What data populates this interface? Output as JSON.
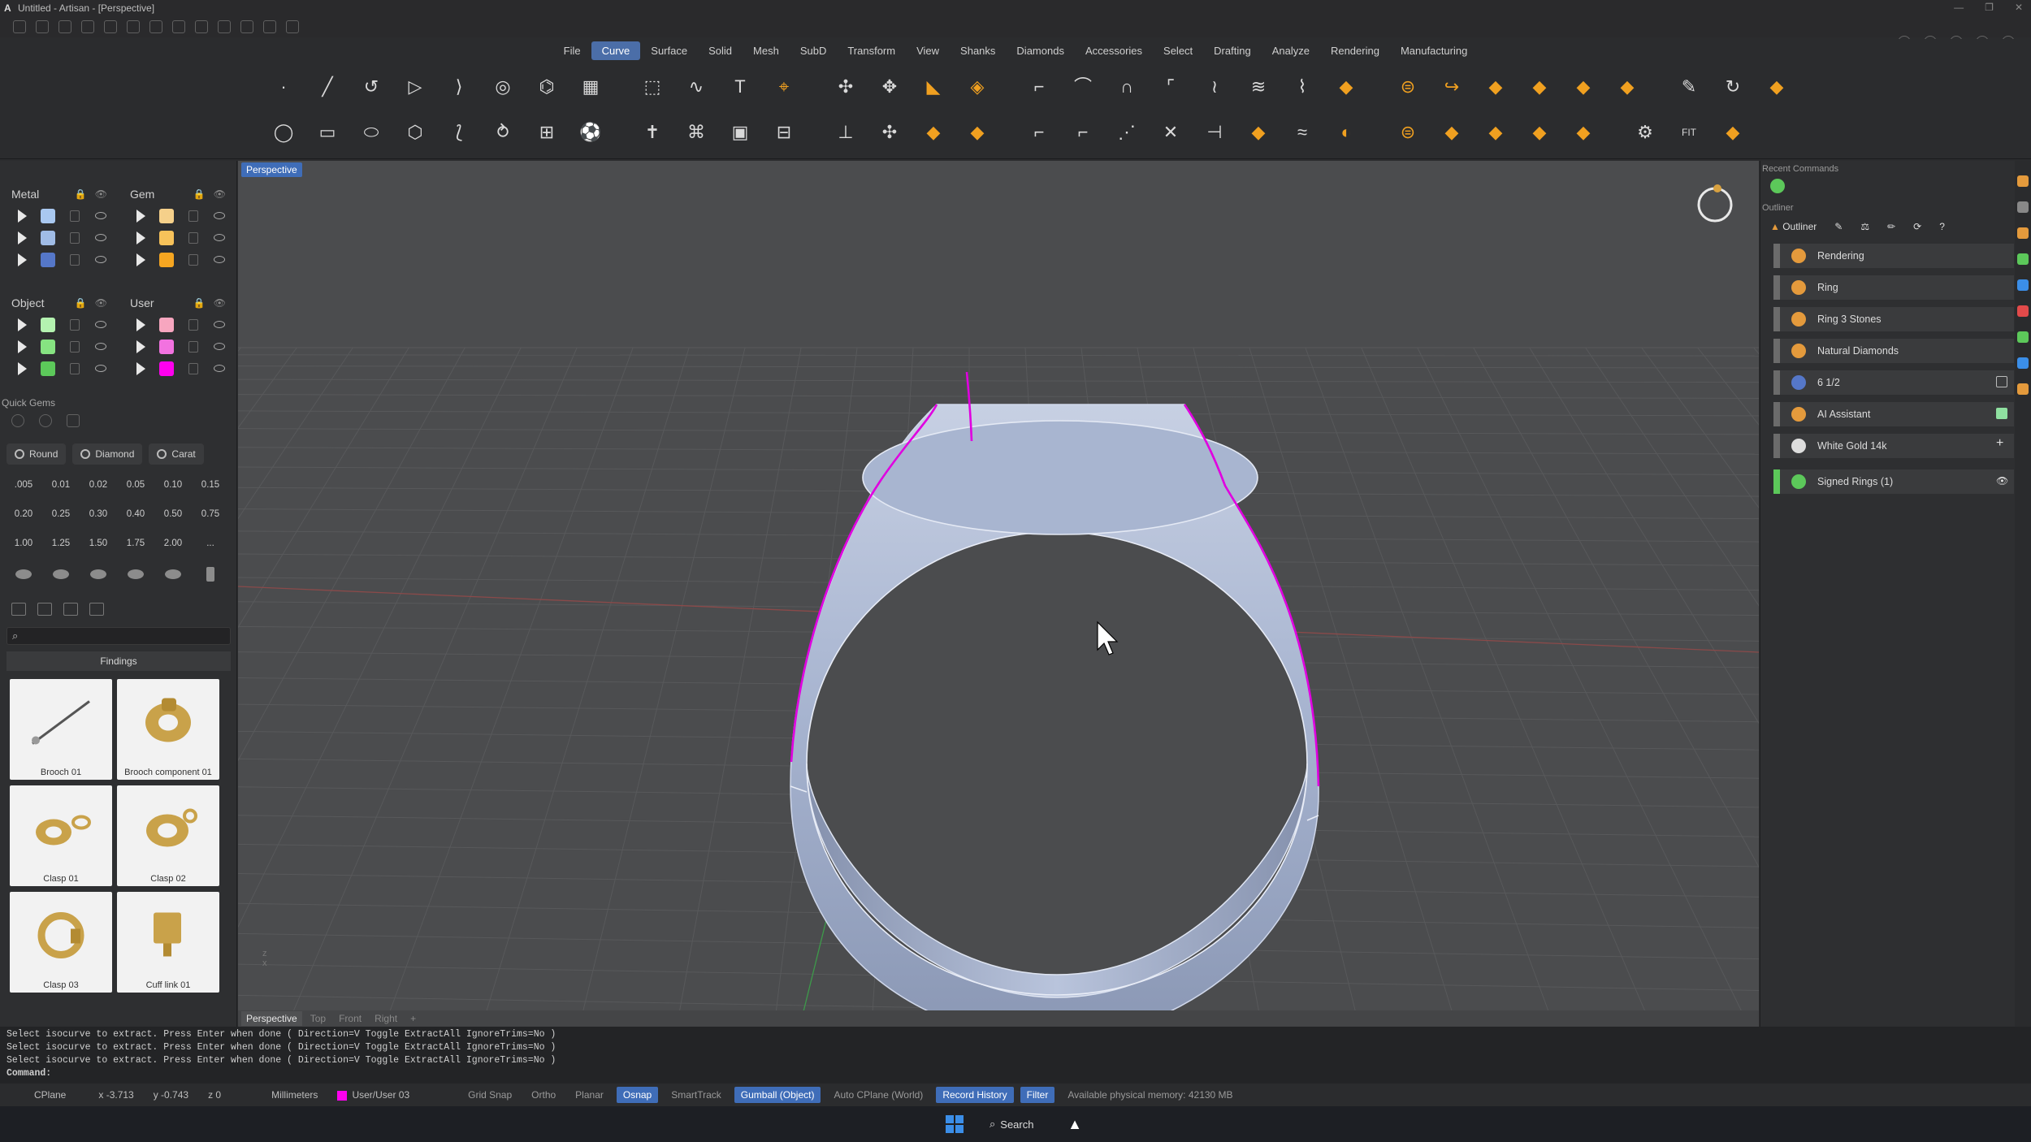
{
  "window": {
    "title": "Untitled - Artisan - [Perspective]",
    "logo": "A"
  },
  "menubar": {
    "items": [
      "File",
      "Curve",
      "Surface",
      "Solid",
      "Mesh",
      "SubD",
      "Transform",
      "View",
      "Shanks",
      "Diamonds",
      "Accessories",
      "Select",
      "Drafting",
      "Analyze",
      "Rendering",
      "Manufacturing"
    ],
    "active": "Curve"
  },
  "layers": {
    "metal": {
      "title": "Metal",
      "swatches": [
        "#a9c8f0",
        "#a0bce6",
        "#5577c8"
      ]
    },
    "gem": {
      "title": "Gem",
      "swatches": [
        "#f5d08a",
        "#f7c25a",
        "#f6a621"
      ]
    },
    "object": {
      "title": "Object",
      "swatches": [
        "#b4f2b0",
        "#86e381",
        "#5cc85a"
      ]
    },
    "user": {
      "title": "User",
      "swatches": [
        "#f7a6bf",
        "#f272e0",
        "#ff00ee"
      ]
    }
  },
  "quick_gems": {
    "title": "Quick Gems",
    "tabs": [
      "Round",
      "Diamond",
      "Carat"
    ],
    "sizes": [
      ".005",
      "0.01",
      "0.02",
      "0.05",
      "0.10",
      "0.15",
      "0.20",
      "0.25",
      "0.30",
      "0.40",
      "0.50",
      "0.75",
      "1.00",
      "1.25",
      "1.50",
      "1.75",
      "2.00",
      "..."
    ]
  },
  "findings": {
    "title": "Findings",
    "search_placeholder": "",
    "items": [
      "Brooch 01",
      "Brooch component 01",
      "Clasp 01",
      "Clasp 02",
      "Clasp 03",
      "Cuff link 01"
    ]
  },
  "viewport": {
    "title": "Perspective",
    "tabs": [
      "Perspective",
      "Top",
      "Front",
      "Right",
      "+"
    ],
    "axis_z": "z",
    "axis_x": "x"
  },
  "right_panel": {
    "recent_label": "Recent Commands",
    "outliner_label": "Outliner",
    "outliner_title": "Outliner",
    "items": [
      {
        "label": "Rendering",
        "icon": "palette-icon",
        "color": "#e49a3c"
      },
      {
        "label": "Ring",
        "icon": "ring-icon",
        "color": "#e49a3c"
      },
      {
        "label": "Ring 3 Stones",
        "icon": "stones-icon",
        "color": "#e49a3c"
      },
      {
        "label": "Natural Diamonds",
        "icon": "diamond-icon",
        "color": "#e49a3c"
      },
      {
        "label": "6 1/2",
        "icon": "flag-icon",
        "color": "#5577c8"
      },
      {
        "label": "AI Assistant",
        "icon": "ai-icon",
        "color": "#e49a3c"
      },
      {
        "label": "White Gold 14k",
        "icon": "sphere-icon",
        "color": "#dddddd"
      },
      {
        "label": "Signed Rings (1)",
        "icon": "brush-icon",
        "color": "#5cc85a"
      }
    ]
  },
  "command": {
    "history": [
      "Select isocurve to extract. Press Enter when done ( Direction=V  Toggle  ExtractAll  IgnoreTrims=No )",
      "Select isocurve to extract. Press Enter when done ( Direction=V  Toggle  ExtractAll  IgnoreTrims=No )",
      "Select isocurve to extract. Press Enter when done ( Direction=V  Toggle  ExtractAll  IgnoreTrims=No )"
    ],
    "prompt": "Command:"
  },
  "status": {
    "cplane": "CPlane",
    "x": "x -3.713",
    "y": "y -0.743",
    "z": "z 0",
    "units": "Millimeters",
    "layer": "User/User 03",
    "grid_snap": "Grid Snap",
    "ortho": "Ortho",
    "planar": "Planar",
    "osnap": "Osnap",
    "smarttrack": "SmartTrack",
    "gumball": "Gumball (Object)",
    "autocplane": "Auto CPlane (World)",
    "record": "Record History",
    "filter": "Filter",
    "memory": "Available physical memory: 42130 MB"
  },
  "taskbar": {
    "search": "Search"
  },
  "colors": {
    "accent": "#3f6db8",
    "selection": "#e000e0",
    "ring": "#a9b8d6"
  }
}
